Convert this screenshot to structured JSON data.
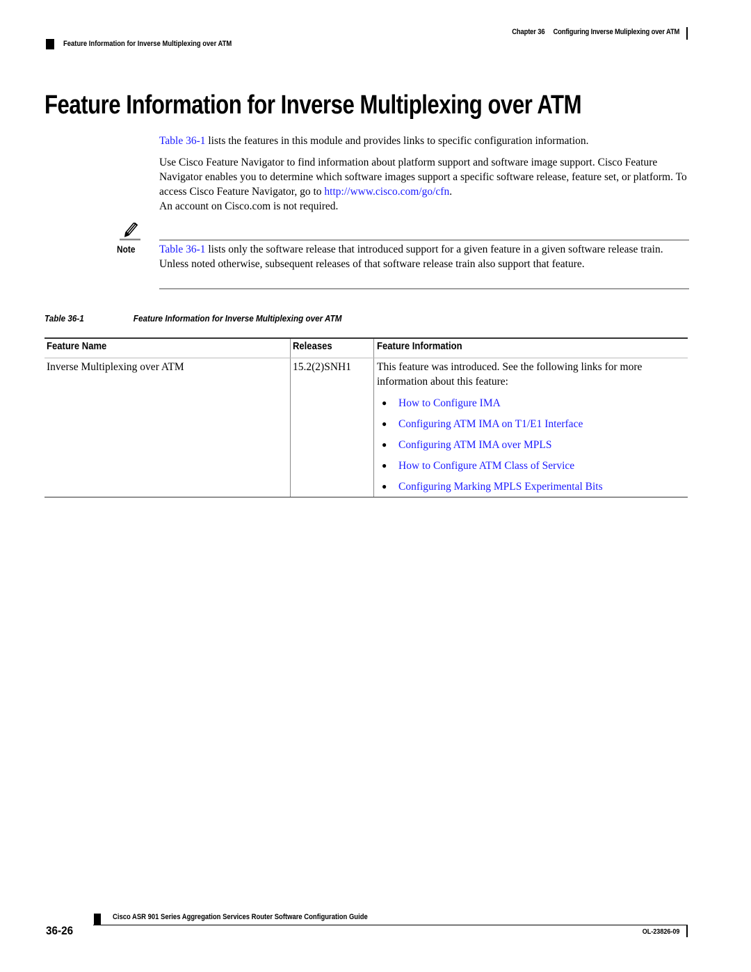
{
  "header": {
    "chapter_label": "Chapter 36",
    "chapter_title": "Configuring Inverse Muliplexing over ATM",
    "section_title": "Feature Information for Inverse Multiplexing over ATM"
  },
  "page_title": "Feature Information for Inverse Multiplexing over ATM",
  "intro": {
    "p1_link": "Table 36-1",
    "p1_text": " lists the features in this module and provides links to specific configuration information.",
    "p2_text": "Use Cisco Feature Navigator to find information about platform support and software image support. Cisco Feature Navigator enables you to determine which software images support a specific software release, feature set, or platform. To access Cisco Feature Navigator, go to ",
    "p2_link": "http://www.cisco.com/go/cfn",
    "p2_after": ".",
    "p3_text": "An account on Cisco.com is not required."
  },
  "note": {
    "icon": "pencil-note-icon",
    "label": "Note",
    "link": "Table 36-1",
    "text": " lists only the software release that introduced support for a given feature in a given software release train. Unless noted otherwise, subsequent releases of that software release train also support that feature."
  },
  "table": {
    "caption_label": "Table 36-1",
    "caption_title": "Feature Information for Inverse Multiplexing over ATM",
    "columns": [
      "Feature Name",
      "Releases",
      "Feature Information"
    ],
    "rows": [
      {
        "feature_name": "Inverse Multiplexing over ATM",
        "release": "15.2(2)SNH1",
        "info_text": "This feature was introduced. See the following links for more information about this feature:",
        "links": [
          "How to Configure IMA",
          "Configuring ATM IMA on T1/E1 Interface",
          "Configuring ATM IMA over MPLS",
          "How to Configure ATM Class of Service",
          "Configuring Marking MPLS Experimental Bits"
        ]
      }
    ]
  },
  "footer": {
    "guide_title": "Cisco ASR 901 Series Aggregation Services Router Software Configuration Guide",
    "page_number": "36-26",
    "doc_number": "OL-23826-09"
  },
  "colors": {
    "link": "#1a1aff",
    "text": "#000000"
  }
}
